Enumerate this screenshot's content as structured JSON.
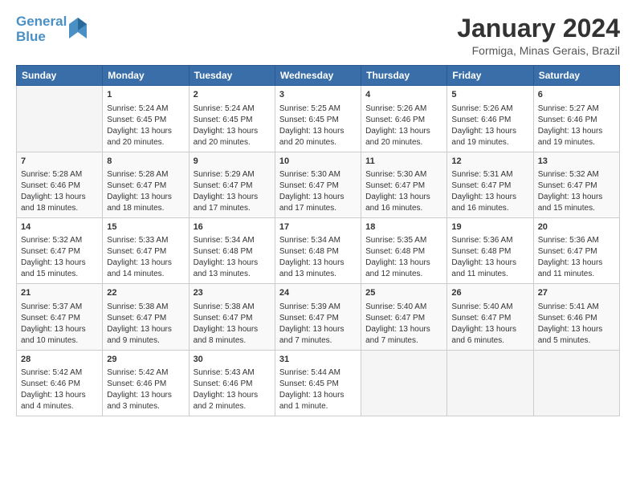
{
  "header": {
    "logo_line1": "General",
    "logo_line2": "Blue",
    "month_year": "January 2024",
    "location": "Formiga, Minas Gerais, Brazil"
  },
  "weekdays": [
    "Sunday",
    "Monday",
    "Tuesday",
    "Wednesday",
    "Thursday",
    "Friday",
    "Saturday"
  ],
  "weeks": [
    [
      {
        "day": "",
        "text": ""
      },
      {
        "day": "1",
        "text": "Sunrise: 5:24 AM\nSunset: 6:45 PM\nDaylight: 13 hours\nand 20 minutes."
      },
      {
        "day": "2",
        "text": "Sunrise: 5:24 AM\nSunset: 6:45 PM\nDaylight: 13 hours\nand 20 minutes."
      },
      {
        "day": "3",
        "text": "Sunrise: 5:25 AM\nSunset: 6:45 PM\nDaylight: 13 hours\nand 20 minutes."
      },
      {
        "day": "4",
        "text": "Sunrise: 5:26 AM\nSunset: 6:46 PM\nDaylight: 13 hours\nand 20 minutes."
      },
      {
        "day": "5",
        "text": "Sunrise: 5:26 AM\nSunset: 6:46 PM\nDaylight: 13 hours\nand 19 minutes."
      },
      {
        "day": "6",
        "text": "Sunrise: 5:27 AM\nSunset: 6:46 PM\nDaylight: 13 hours\nand 19 minutes."
      }
    ],
    [
      {
        "day": "7",
        "text": "Sunrise: 5:28 AM\nSunset: 6:46 PM\nDaylight: 13 hours\nand 18 minutes."
      },
      {
        "day": "8",
        "text": "Sunrise: 5:28 AM\nSunset: 6:47 PM\nDaylight: 13 hours\nand 18 minutes."
      },
      {
        "day": "9",
        "text": "Sunrise: 5:29 AM\nSunset: 6:47 PM\nDaylight: 13 hours\nand 17 minutes."
      },
      {
        "day": "10",
        "text": "Sunrise: 5:30 AM\nSunset: 6:47 PM\nDaylight: 13 hours\nand 17 minutes."
      },
      {
        "day": "11",
        "text": "Sunrise: 5:30 AM\nSunset: 6:47 PM\nDaylight: 13 hours\nand 16 minutes."
      },
      {
        "day": "12",
        "text": "Sunrise: 5:31 AM\nSunset: 6:47 PM\nDaylight: 13 hours\nand 16 minutes."
      },
      {
        "day": "13",
        "text": "Sunrise: 5:32 AM\nSunset: 6:47 PM\nDaylight: 13 hours\nand 15 minutes."
      }
    ],
    [
      {
        "day": "14",
        "text": "Sunrise: 5:32 AM\nSunset: 6:47 PM\nDaylight: 13 hours\nand 15 minutes."
      },
      {
        "day": "15",
        "text": "Sunrise: 5:33 AM\nSunset: 6:47 PM\nDaylight: 13 hours\nand 14 minutes."
      },
      {
        "day": "16",
        "text": "Sunrise: 5:34 AM\nSunset: 6:48 PM\nDaylight: 13 hours\nand 13 minutes."
      },
      {
        "day": "17",
        "text": "Sunrise: 5:34 AM\nSunset: 6:48 PM\nDaylight: 13 hours\nand 13 minutes."
      },
      {
        "day": "18",
        "text": "Sunrise: 5:35 AM\nSunset: 6:48 PM\nDaylight: 13 hours\nand 12 minutes."
      },
      {
        "day": "19",
        "text": "Sunrise: 5:36 AM\nSunset: 6:48 PM\nDaylight: 13 hours\nand 11 minutes."
      },
      {
        "day": "20",
        "text": "Sunrise: 5:36 AM\nSunset: 6:47 PM\nDaylight: 13 hours\nand 11 minutes."
      }
    ],
    [
      {
        "day": "21",
        "text": "Sunrise: 5:37 AM\nSunset: 6:47 PM\nDaylight: 13 hours\nand 10 minutes."
      },
      {
        "day": "22",
        "text": "Sunrise: 5:38 AM\nSunset: 6:47 PM\nDaylight: 13 hours\nand 9 minutes."
      },
      {
        "day": "23",
        "text": "Sunrise: 5:38 AM\nSunset: 6:47 PM\nDaylight: 13 hours\nand 8 minutes."
      },
      {
        "day": "24",
        "text": "Sunrise: 5:39 AM\nSunset: 6:47 PM\nDaylight: 13 hours\nand 7 minutes."
      },
      {
        "day": "25",
        "text": "Sunrise: 5:40 AM\nSunset: 6:47 PM\nDaylight: 13 hours\nand 7 minutes."
      },
      {
        "day": "26",
        "text": "Sunrise: 5:40 AM\nSunset: 6:47 PM\nDaylight: 13 hours\nand 6 minutes."
      },
      {
        "day": "27",
        "text": "Sunrise: 5:41 AM\nSunset: 6:46 PM\nDaylight: 13 hours\nand 5 minutes."
      }
    ],
    [
      {
        "day": "28",
        "text": "Sunrise: 5:42 AM\nSunset: 6:46 PM\nDaylight: 13 hours\nand 4 minutes."
      },
      {
        "day": "29",
        "text": "Sunrise: 5:42 AM\nSunset: 6:46 PM\nDaylight: 13 hours\nand 3 minutes."
      },
      {
        "day": "30",
        "text": "Sunrise: 5:43 AM\nSunset: 6:46 PM\nDaylight: 13 hours\nand 2 minutes."
      },
      {
        "day": "31",
        "text": "Sunrise: 5:44 AM\nSunset: 6:45 PM\nDaylight: 13 hours\nand 1 minute."
      },
      {
        "day": "",
        "text": ""
      },
      {
        "day": "",
        "text": ""
      },
      {
        "day": "",
        "text": ""
      }
    ]
  ]
}
